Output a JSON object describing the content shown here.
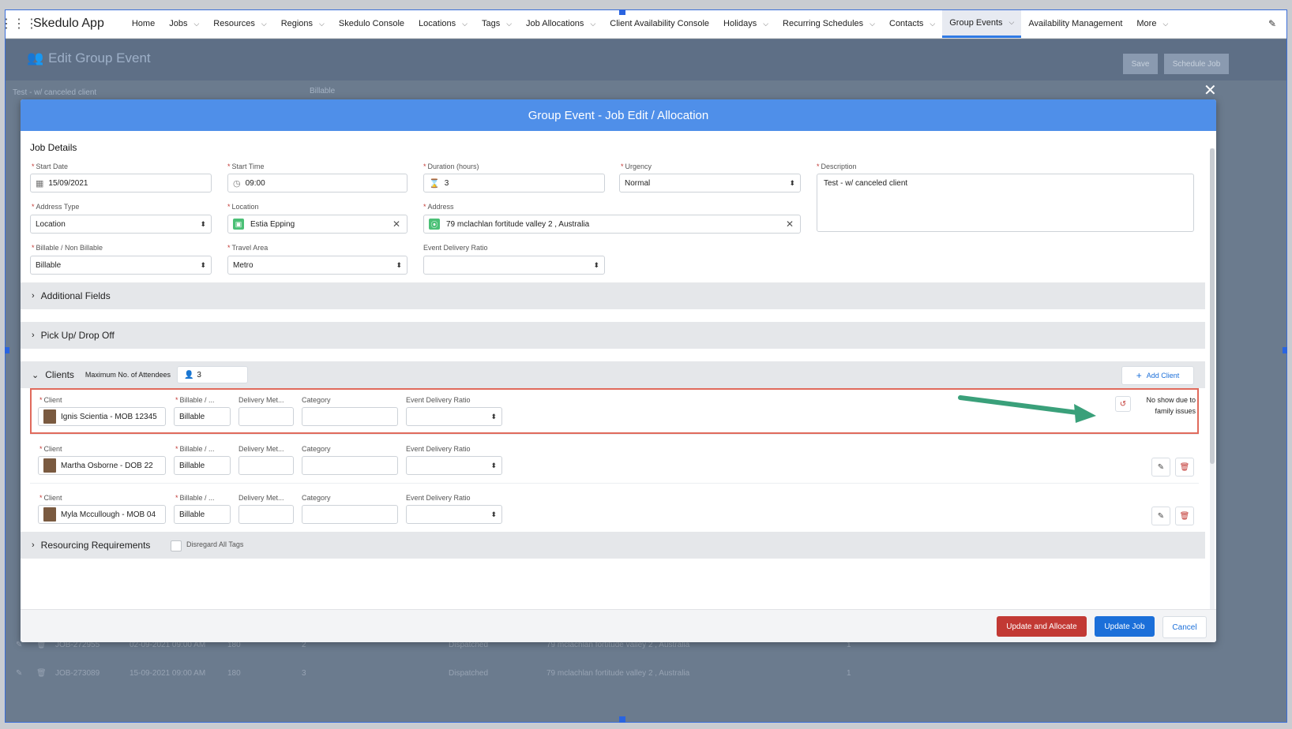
{
  "app": {
    "name": "Skedulo App"
  },
  "nav": {
    "items": [
      {
        "label": "Home",
        "chev": false
      },
      {
        "label": "Jobs",
        "chev": true
      },
      {
        "label": "Resources",
        "chev": true
      },
      {
        "label": "Regions",
        "chev": true
      },
      {
        "label": "Skedulo Console",
        "chev": false
      },
      {
        "label": "Locations",
        "chev": true
      },
      {
        "label": "Tags",
        "chev": true
      },
      {
        "label": "Job Allocations",
        "chev": true
      },
      {
        "label": "Client Availability Console",
        "chev": false
      },
      {
        "label": "Holidays",
        "chev": true
      },
      {
        "label": "Recurring Schedules",
        "chev": true
      },
      {
        "label": "Contacts",
        "chev": true
      },
      {
        "label": "Group Events",
        "chev": true,
        "active": true
      },
      {
        "label": "Availability Management",
        "chev": false
      },
      {
        "label": "More",
        "chev": true
      }
    ]
  },
  "background": {
    "title": "Edit Group Event",
    "save": "Save",
    "schedule": "Schedule Job",
    "sub_left": "Test - w/ canceled client",
    "sub_mid": "Billable",
    "rows": [
      {
        "job": "JOB-272955",
        "date": "02-09-2021 09:00 AM",
        "dur": "180",
        "n": "2",
        "status": "Dispatched",
        "addr": "79 mclachlan fortitude valley 2 , Australia",
        "c": "1"
      },
      {
        "job": "JOB-273089",
        "date": "15-09-2021 09:00 AM",
        "dur": "180",
        "n": "3",
        "status": "Dispatched",
        "addr": "79 mclachlan fortitude valley 2 , Australia",
        "c": "1"
      }
    ]
  },
  "modal": {
    "title": "Group Event - Job Edit / Allocation",
    "job_details": "Job Details",
    "start_date": {
      "label": "Start Date",
      "value": "15/09/2021"
    },
    "start_time": {
      "label": "Start Time",
      "value": "09:00"
    },
    "duration": {
      "label": "Duration (hours)",
      "value": "3"
    },
    "urgency": {
      "label": "Urgency",
      "value": "Normal"
    },
    "description": {
      "label": "Description",
      "value": "Test - w/ canceled client"
    },
    "address_type": {
      "label": "Address Type",
      "value": "Location"
    },
    "location": {
      "label": "Location",
      "value": "Estia Epping"
    },
    "address": {
      "label": "Address",
      "value": "79 mclachlan fortitude valley 2 , Australia"
    },
    "billable": {
      "label": "Billable / Non Billable",
      "value": "Billable"
    },
    "travel_area": {
      "label": "Travel Area",
      "value": "Metro"
    },
    "event_ratio": {
      "label": "Event Delivery Ratio",
      "value": ""
    },
    "additional_fields": "Additional Fields",
    "pickup": "Pick Up/ Drop Off",
    "clients": {
      "title": "Clients",
      "max_label": "Maximum No. of Attendees",
      "max_value": "3",
      "add_label": "Add Client",
      "col_client": "Client",
      "col_billable": "Billable / ...",
      "col_delivery": "Delivery Met...",
      "col_category": "Category",
      "col_ratio": "Event Delivery Ratio",
      "no_show": "No show due to family issues",
      "rows": [
        {
          "name": "Ignis Scientia - MOB 12345",
          "billable": "Billable"
        },
        {
          "name": "Martha Osborne - DOB 22",
          "billable": "Billable"
        },
        {
          "name": "Myla Mccullough - MOB 04",
          "billable": "Billable"
        }
      ]
    },
    "resourcing": "Resourcing Requirements",
    "disregard": "Disregard All Tags",
    "btn_update_allocate": "Update and Allocate",
    "btn_update_job": "Update Job",
    "btn_cancel": "Cancel"
  },
  "colors": {
    "accent": "#4f8fe9",
    "danger": "#c23934",
    "primary": "#1b6fd9",
    "arrow": "#3aa07a"
  }
}
